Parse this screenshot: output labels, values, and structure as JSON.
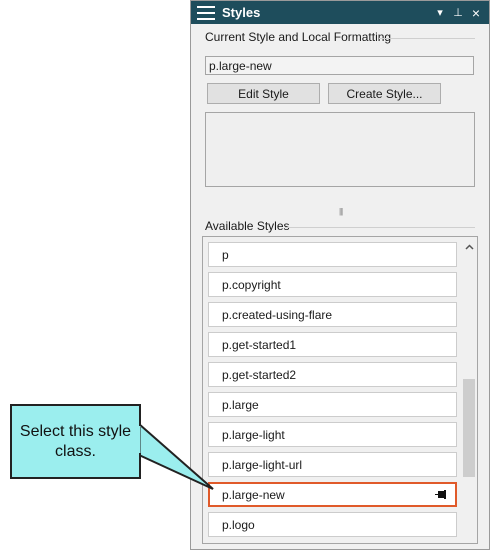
{
  "panel": {
    "title": "Styles",
    "controls": {
      "dropdown": "▾",
      "pin": "⊥",
      "close": "×"
    }
  },
  "current_style": {
    "group_label": "Current Style and Local Formatting",
    "value": "p.large-new",
    "edit_button": "Edit Style",
    "create_button": "Create Style..."
  },
  "available_styles": {
    "group_label": "Available Styles",
    "items": [
      "p",
      "p.copyright",
      "p.created-using-flare",
      "p.get-started1",
      "p.get-started2",
      "p.large",
      "p.large-light",
      "p.large-light-url",
      "p.large-new",
      "p.logo"
    ],
    "selected": "p.large-new"
  },
  "callout": {
    "text": "Select this style class."
  },
  "colors": {
    "titlebar": "#1e4d5c",
    "selection_border": "#e05a2a",
    "callout_fill": "#9beeee"
  }
}
